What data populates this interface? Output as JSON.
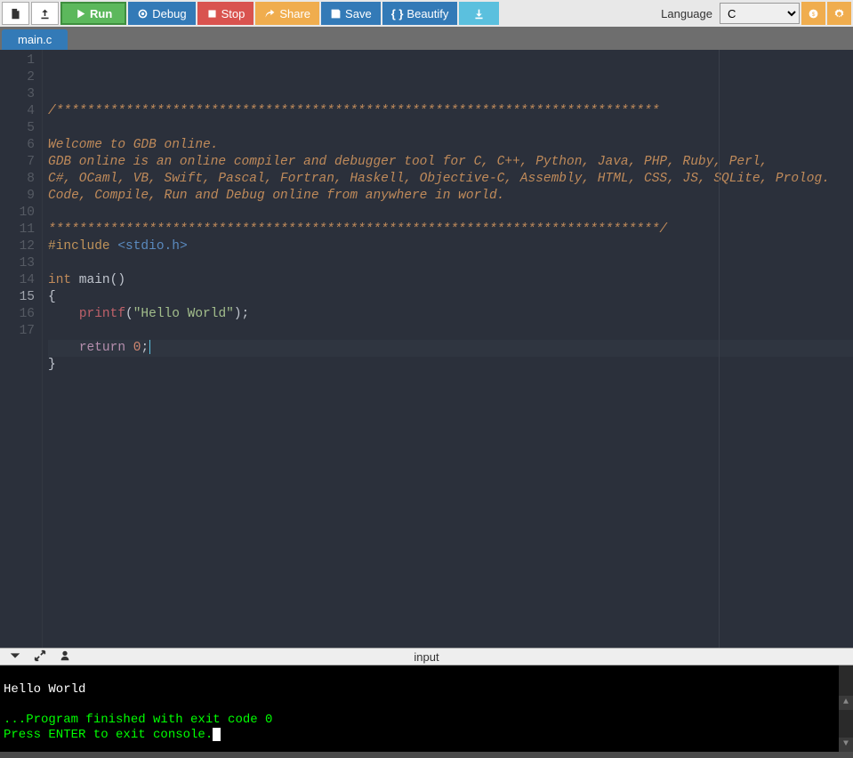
{
  "toolbar": {
    "run": "Run",
    "debug": "Debug",
    "stop": "Stop",
    "share": "Share",
    "save": "Save",
    "beautify": "Beautify",
    "language_label": "Language",
    "language_selected": "C"
  },
  "tabs": {
    "active": "main.c"
  },
  "editor": {
    "active_line": 15,
    "lines": [
      {
        "n": 1,
        "type": "comment",
        "text": "/******************************************************************************"
      },
      {
        "n": 2,
        "type": "blank",
        "text": ""
      },
      {
        "n": 3,
        "type": "comment",
        "text": "Welcome to GDB online."
      },
      {
        "n": 4,
        "type": "comment",
        "text": "GDB online is an online compiler and debugger tool for C, C++, Python, Java, PHP, Ruby, Perl,"
      },
      {
        "n": 5,
        "type": "comment",
        "text": "C#, OCaml, VB, Swift, Pascal, Fortran, Haskell, Objective-C, Assembly, HTML, CSS, JS, SQLite, Prolog."
      },
      {
        "n": 6,
        "type": "comment",
        "text": "Code, Compile, Run and Debug online from anywhere in world."
      },
      {
        "n": 7,
        "type": "blank",
        "text": ""
      },
      {
        "n": 8,
        "type": "comment",
        "text": "*******************************************************************************/"
      },
      {
        "n": 9,
        "type": "include",
        "directive": "#include ",
        "header": "<stdio.h>"
      },
      {
        "n": 10,
        "type": "blank",
        "text": ""
      },
      {
        "n": 11,
        "type": "signature",
        "ret": "int",
        "name": " main",
        "params": "()"
      },
      {
        "n": 12,
        "type": "plain",
        "text": "{"
      },
      {
        "n": 13,
        "type": "printf",
        "indent": "    ",
        "fn": "printf",
        "open": "(",
        "str": "\"Hello World\"",
        "close": ");"
      },
      {
        "n": 14,
        "type": "blank",
        "text": ""
      },
      {
        "n": 15,
        "type": "return",
        "indent": "    ",
        "kw": "return ",
        "val": "0",
        "end": ";"
      },
      {
        "n": 16,
        "type": "plain",
        "text": "}"
      },
      {
        "n": 17,
        "type": "blank",
        "text": ""
      }
    ]
  },
  "console": {
    "title": "input",
    "output_line": "Hello World",
    "status_line": "...Program finished with exit code 0",
    "prompt_line": "Press ENTER to exit console."
  }
}
